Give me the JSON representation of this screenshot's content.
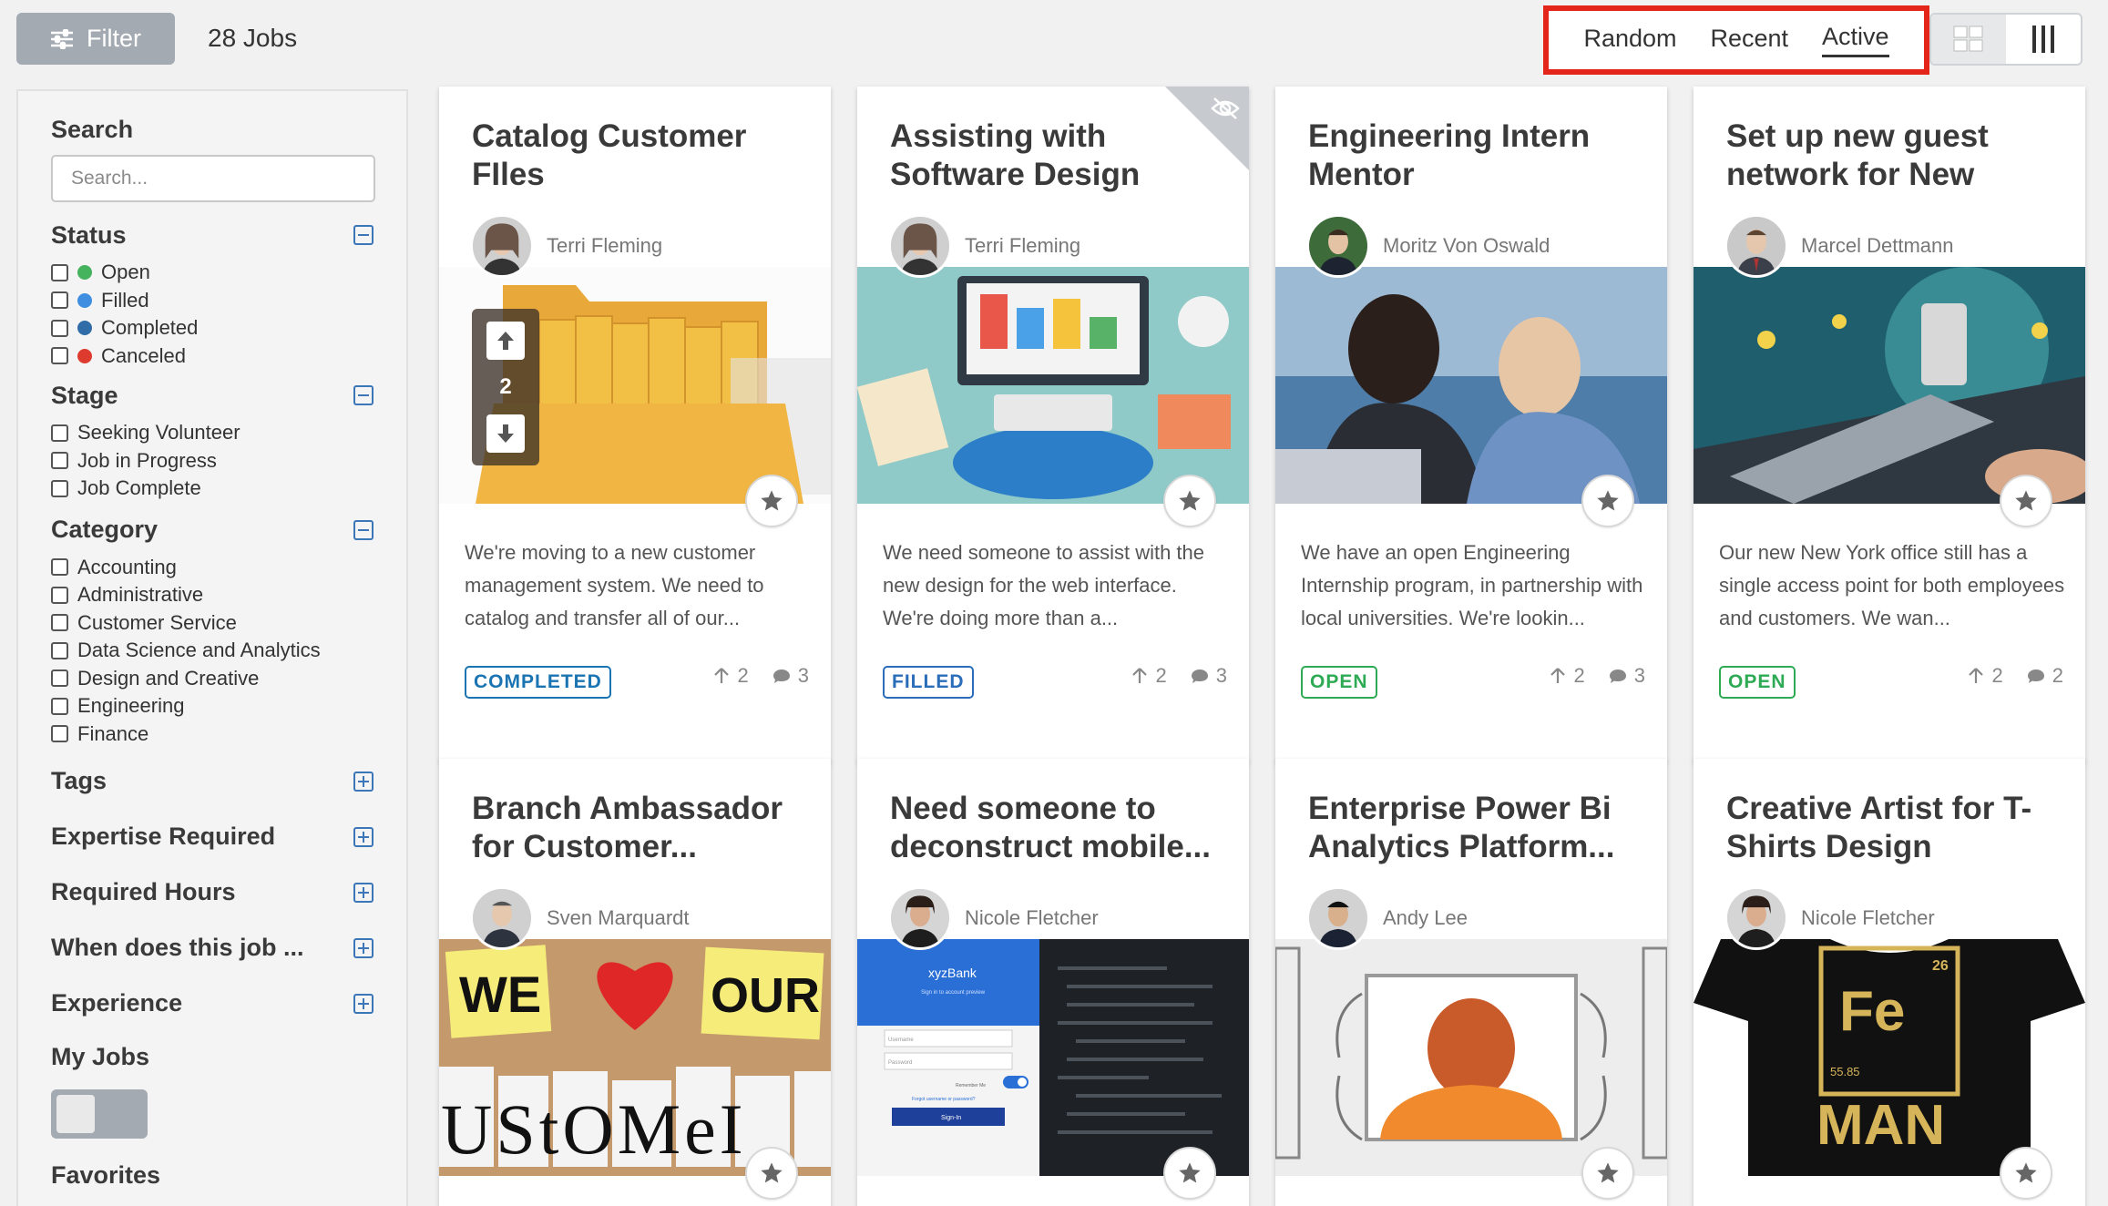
{
  "topbar": {
    "filter_label": "Filter",
    "jobs_count": "28 Jobs",
    "sort_options": [
      "Random",
      "Recent",
      "Active"
    ],
    "sort_active": "Active",
    "highlight_color": "#e32619"
  },
  "sidebar": {
    "search": {
      "label": "Search",
      "placeholder": "Search..."
    },
    "status": {
      "label": "Status",
      "items": [
        {
          "label": "Open",
          "color": "#45b25d"
        },
        {
          "label": "Filled",
          "color": "#3f8ee0"
        },
        {
          "label": "Completed",
          "color": "#2f6ca8"
        },
        {
          "label": "Canceled",
          "color": "#de3b2f"
        }
      ]
    },
    "stage": {
      "label": "Stage",
      "items": [
        "Seeking Volunteer",
        "Job in Progress",
        "Job Complete"
      ]
    },
    "category": {
      "label": "Category",
      "items": [
        "Accounting",
        "Administrative",
        "Customer Service",
        "Data Science and Analytics",
        "Design and Creative",
        "Engineering",
        "Finance"
      ]
    },
    "collapsed": [
      "Tags",
      "Expertise Required",
      "Required Hours",
      "When does this job ...",
      "Experience"
    ],
    "my_jobs": "My Jobs",
    "favorites": "Favorites"
  },
  "cards": [
    {
      "title": "Catalog Customer FIles",
      "author": "Terri Fleming",
      "desc": "We're moving to a new customer management system. We need to catalog and transfer all of our...",
      "badge": "COMPLETED",
      "votes": "2",
      "comments": "3",
      "vote_count": "2",
      "image": "folders"
    },
    {
      "title": "Assisting with Software Design",
      "author": "Terri Fleming",
      "desc": "We need someone to assist with the new design for the web interface. We're doing more than a...",
      "badge": "FILLED",
      "votes": "2",
      "comments": "3",
      "image": "desk"
    },
    {
      "title": "Engineering Intern Mentor",
      "author": "Moritz Von Oswald",
      "desc": "We have an open Engineering Internship program, in partnership with local universities. We're lookin...",
      "badge": "OPEN",
      "votes": "2",
      "comments": "3",
      "image": "team"
    },
    {
      "title": "Set up new guest network for New Yor...",
      "author": "Marcel Dettmann",
      "desc": "Our new New York office still has a single access point for both employees and customers. We wan...",
      "badge": "OPEN",
      "votes": "2",
      "comments": "2",
      "image": "laptop"
    },
    {
      "title": "Branch Ambassador for Customer...",
      "author": "Sven Marquardt",
      "image": "customers",
      "img_text": {
        "w1": "WE",
        "w2": "OUR",
        "w3": "UStOMeI"
      }
    },
    {
      "title": "Need someone to deconstruct mobile...",
      "author": "Nicole Fletcher",
      "image": "mobile",
      "img_text": {
        "brand": "xyzBank",
        "sub": "Sign in to account preview",
        "user": "Username",
        "pass": "Password",
        "remember": "Remember Me",
        "forgot": "Forgot username or password?",
        "signin": "Sign-In"
      }
    },
    {
      "title": "Enterprise Power Bi Analytics Platform...",
      "author": "Andy Lee",
      "image": "monitor"
    },
    {
      "title": "Creative Artist for T-Shirts Design Graphi...",
      "author": "Nicole Fletcher",
      "image": "tshirt",
      "img_text": {
        "num": "26",
        "sym": "Fe",
        "mass": "55.85",
        "word": "MAN"
      }
    }
  ]
}
